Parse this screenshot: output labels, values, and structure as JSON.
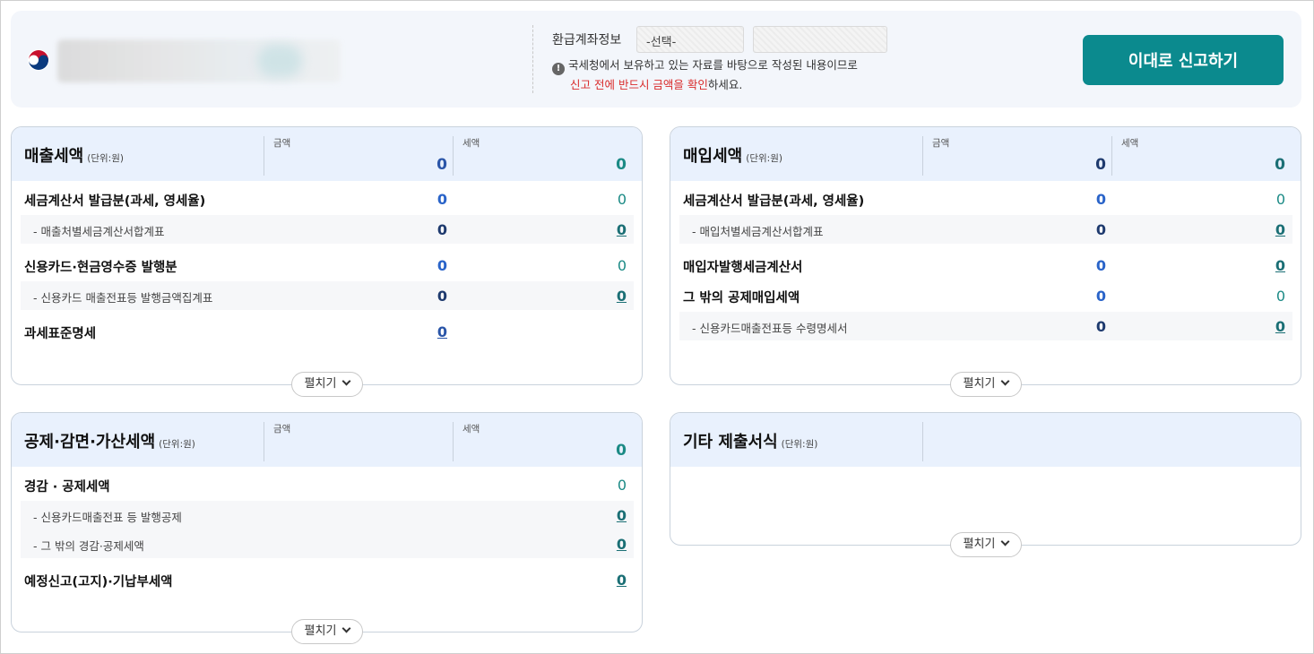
{
  "header": {
    "refund_label": "환급계좌정보",
    "select_value": "-선택-",
    "select2_value": "",
    "notice_line1": "국세청에서 보유하고 있는 자료를 바탕으로 작성된 내용이므로",
    "notice_red": "신고 전에 반드시 금액을 확인",
    "notice_tail": "하세요.",
    "submit_label": "이대로 신고하기"
  },
  "common": {
    "unit": "(단위:원)",
    "amount_label": "금액",
    "tax_label": "세액",
    "expand_label": "펼치기"
  },
  "sales": {
    "title": "매출세액",
    "amount_total": "0",
    "tax_total": "0",
    "rows": [
      {
        "label": "세금계산서 발급분(과세, 영세율)",
        "amount": "0",
        "tax": "0"
      },
      {
        "label": "- 매출처별세금계산서합계표",
        "amount": "0",
        "tax": "0"
      },
      {
        "label": "신용카드·현금영수증 발행분",
        "amount": "0",
        "tax": "0"
      },
      {
        "label": "- 신용카드 매출전표등 발행금액집계표",
        "amount": "0",
        "tax": "0"
      },
      {
        "label": "과세표준명세",
        "amount": "0"
      }
    ]
  },
  "purchase": {
    "title": "매입세액",
    "amount_total": "0",
    "tax_total": "0",
    "rows": [
      {
        "label": "세금계산서 발급분(과세, 영세율)",
        "amount": "0",
        "tax": "0"
      },
      {
        "label": "- 매입처별세금계산서합계표",
        "amount": "0",
        "tax": "0"
      },
      {
        "label": "매입자발행세금계산서",
        "amount": "0",
        "tax": "0"
      },
      {
        "label": "그 밖의 공제매입세액",
        "amount": "0",
        "tax": "0"
      },
      {
        "label": "- 신용카드매출전표등 수령명세서",
        "amount": "0",
        "tax": "0"
      }
    ]
  },
  "deduction": {
    "title": "공제·감면·가산세액",
    "tax_total": "0",
    "rows": [
      {
        "label": "경감 · 공제세액",
        "tax": "0"
      },
      {
        "label": "- 신용카드매출전표 등 발행공제",
        "tax": "0"
      },
      {
        "label": "- 그 밖의 경감·공제세액",
        "tax": "0"
      },
      {
        "label": "예정신고(고지)·기납부세액",
        "tax": "0"
      }
    ]
  },
  "other": {
    "title": "기타 제출서식"
  }
}
